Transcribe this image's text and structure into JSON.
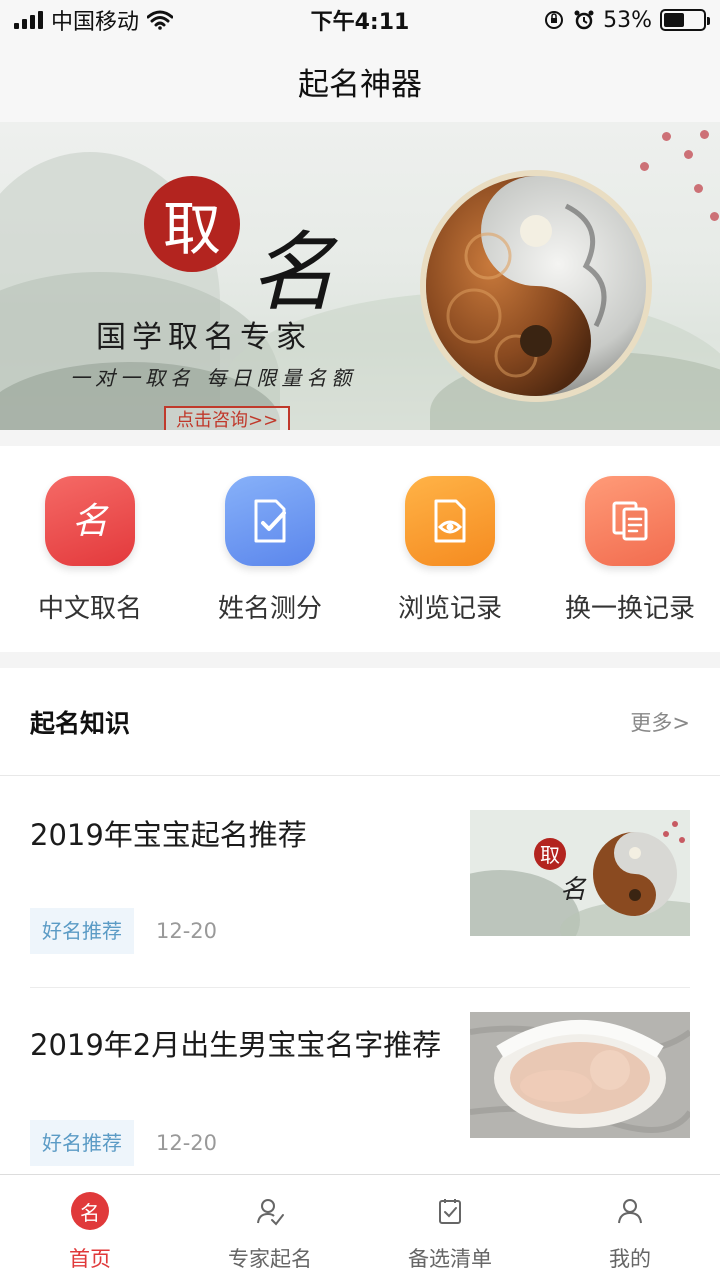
{
  "status_bar": {
    "carrier": "中国移动",
    "time": "下午4:11",
    "battery": "53%",
    "battery_level": 0.53
  },
  "nav": {
    "title": "起名神器"
  },
  "banner": {
    "seal_char": "取",
    "big_char": "名",
    "title": "国学取名专家",
    "subtitle": "一对一取名 每日限量名额",
    "button": "点击咨询>>"
  },
  "quick_menu": [
    {
      "label": "中文取名",
      "icon": "name-seal-icon",
      "color": "#e8423f"
    },
    {
      "label": "姓名测分",
      "icon": "document-check-icon",
      "color": "#6b93ef"
    },
    {
      "label": "浏览记录",
      "icon": "document-eye-icon",
      "color": "#f7952a"
    },
    {
      "label": "换一换记录",
      "icon": "copy-documents-icon",
      "color": "#f57a5a"
    }
  ],
  "knowledge": {
    "title": "起名知识",
    "more": "更多>",
    "articles": [
      {
        "title": "2019年宝宝起名推荐",
        "tag": "好名推荐",
        "date": "12-20",
        "thumb": "banner-thumbnail",
        "thumb_seal": "取",
        "thumb_char": "名"
      },
      {
        "title": "2019年2月出生男宝宝名字推荐",
        "tag": "好名推荐",
        "date": "12-20",
        "thumb": "baby-photo-thumbnail"
      }
    ]
  },
  "tabs": [
    {
      "label": "首页",
      "icon": "home-icon",
      "active": true,
      "badge": "名"
    },
    {
      "label": "专家起名",
      "icon": "expert-icon",
      "active": false
    },
    {
      "label": "备选清单",
      "icon": "checklist-icon",
      "active": false
    },
    {
      "label": "我的",
      "icon": "user-icon",
      "active": false
    }
  ],
  "colors": {
    "accent": "#e0393a",
    "tag_bg": "#eef5fb",
    "tag_text": "#5b9bc5"
  }
}
